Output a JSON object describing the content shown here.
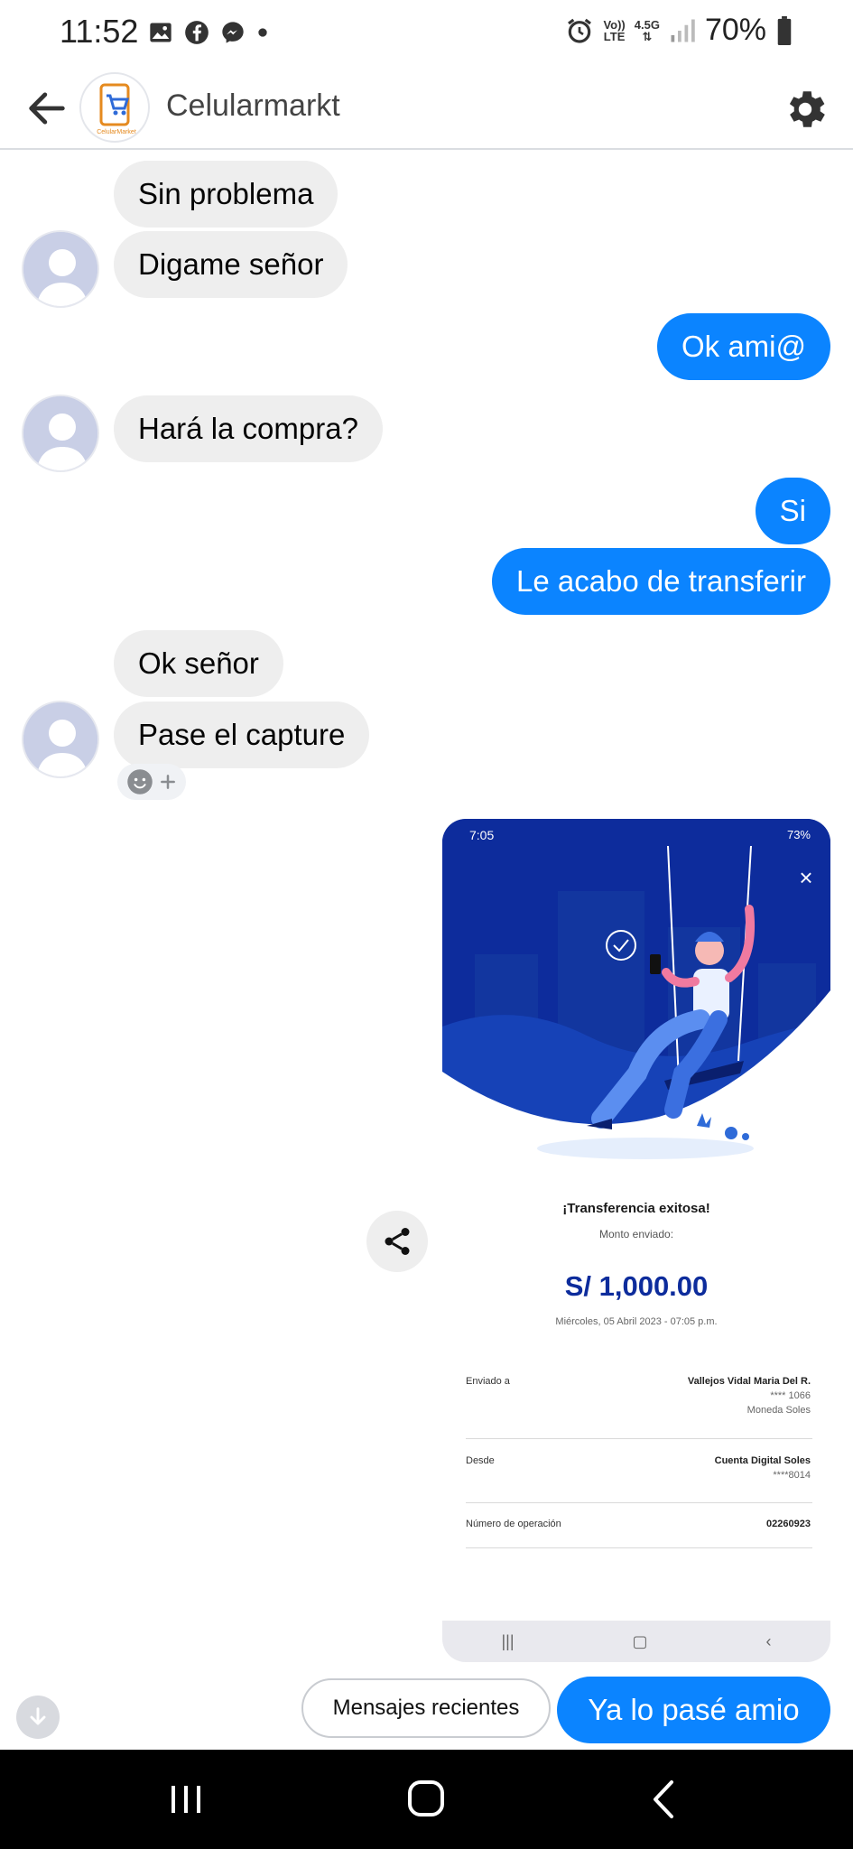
{
  "status_bar": {
    "time": "11:52",
    "network_top": "Vo))",
    "network_bottom": "LTE",
    "data_top": "4.5G",
    "battery": "70%"
  },
  "header": {
    "title": "Celularmarkt",
    "avatar_text": "CelularMarket"
  },
  "messages": [
    {
      "from": "them",
      "text": "Sin problema"
    },
    {
      "from": "them",
      "text": "Digame señor"
    },
    {
      "from": "me",
      "text": "Ok ami@"
    },
    {
      "from": "them",
      "text": "Hará la compra?"
    },
    {
      "from": "me",
      "text": "Si"
    },
    {
      "from": "me",
      "text": "Le acabo de transferir"
    },
    {
      "from": "them",
      "text": "Ok señor"
    },
    {
      "from": "them",
      "text": "Pase el capture"
    }
  ],
  "screenshot": {
    "status_time": "7:05",
    "status_battery": "73%",
    "title": "¡Transferencia exitosa!",
    "subtitle": "Monto enviado:",
    "amount": "S/ 1,000.00",
    "date": "Miércoles, 05 Abril 2023 - 07:05 p.m.",
    "rows": [
      {
        "label": "Enviado a",
        "value": "Vallejos Vidal Maria Del R.",
        "line2": "**** 1066",
        "line3": "Moneda Soles"
      },
      {
        "label": "Desde",
        "value": "Cuenta Digital Soles",
        "line2": "****8014",
        "line3": ""
      },
      {
        "label": "Número de operación",
        "value": "02260923",
        "line2": "",
        "line3": ""
      }
    ]
  },
  "quick_replies": {
    "recent": "Mensajes recientes",
    "suggested": "Ya lo pasé amio"
  },
  "colors": {
    "outgoing_bubble": "#0b84ff",
    "incoming_bubble": "#eeeeee",
    "bank_blue": "#0d2c9c"
  }
}
